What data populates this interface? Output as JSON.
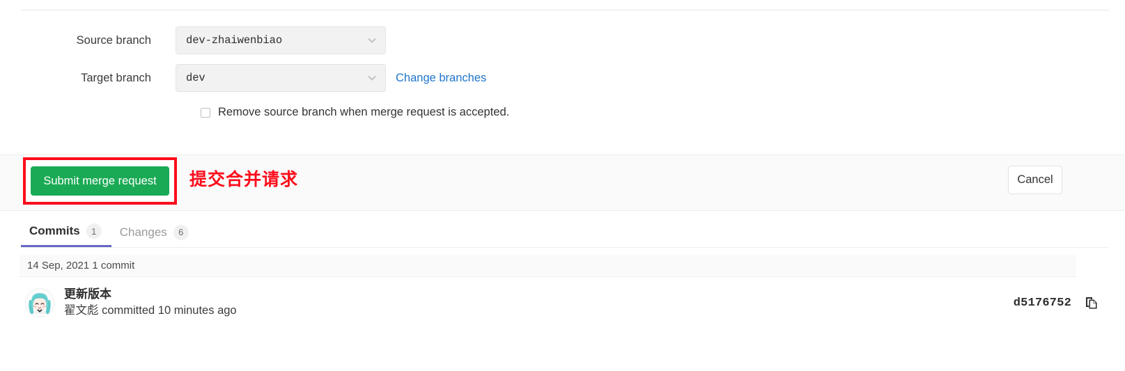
{
  "form": {
    "source_branch_label": "Source branch",
    "source_branch_value": "dev-zhaiwenbiao",
    "target_branch_label": "Target branch",
    "target_branch_value": "dev",
    "change_branches_link": "Change branches",
    "remove_source_branch_label": "Remove source branch when merge request is accepted.",
    "remove_source_branch_checked": false
  },
  "actions": {
    "submit_label": "Submit merge request",
    "cancel_label": "Cancel",
    "annotation_text": "提交合并请求",
    "submit_color": "#1aaa55",
    "annotation_color": "#fc0d1b",
    "highlight_box_color": "#fc0d1b",
    "link_color": "#1f75cb"
  },
  "tabs": [
    {
      "label": "Commits",
      "badge": "1",
      "active": true
    },
    {
      "label": "Changes",
      "badge": "6",
      "active": false
    }
  ],
  "commits": {
    "date_header": "14 Sep, 2021 1 commit",
    "items": [
      {
        "title": "更新版本",
        "meta": "翟文彪 committed 10 minutes ago",
        "sha": "d5176752"
      }
    ]
  }
}
